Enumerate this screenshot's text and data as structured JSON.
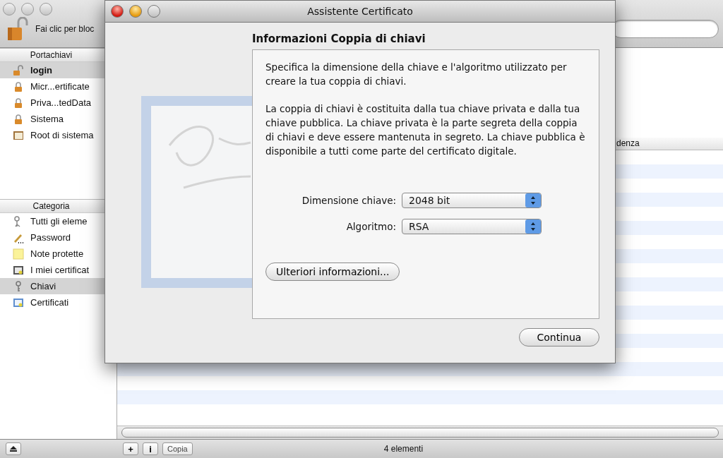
{
  "background_window": {
    "toolbar": {
      "lock_label": "Fai clic per bloc"
    },
    "keychains": {
      "header": "Portachiavi",
      "items": [
        {
          "label": "login",
          "kind": "unlocked",
          "selected": true
        },
        {
          "label": "Micr...ertificate",
          "kind": "locked",
          "selected": false
        },
        {
          "label": "Priva...tedData",
          "kind": "locked",
          "selected": false
        },
        {
          "label": "Sistema",
          "kind": "locked",
          "selected": false
        },
        {
          "label": "Root di sistema",
          "kind": "cabinet",
          "selected": false
        }
      ]
    },
    "categories": {
      "header": "Categoria",
      "items": [
        {
          "label": "Tutti gli eleme",
          "kind": "people",
          "selected": false
        },
        {
          "label": "Password",
          "kind": "pen",
          "selected": false
        },
        {
          "label": "Note protette",
          "kind": "note",
          "selected": false
        },
        {
          "label": "I miei certificat",
          "kind": "mycert",
          "selected": false
        },
        {
          "label": "Chiavi",
          "kind": "key",
          "selected": true
        },
        {
          "label": "Certificati",
          "kind": "cert",
          "selected": false
        }
      ]
    },
    "table": {
      "columns": [
        {
          "label": "denza"
        }
      ]
    },
    "bottom_bar": {
      "buttons": [
        {
          "label": "+"
        },
        {
          "label": "i"
        },
        {
          "label": "Copia"
        }
      ],
      "count": "4 elementi"
    }
  },
  "dialog": {
    "title": "Assistente Certificato",
    "heading": "Informazioni Coppia di chiavi",
    "paragraphs": [
      "Specifica la dimensione della chiave e l'algoritmo utilizzato per creare la tua coppia di chiavi.",
      "La coppia di chiavi è costituita dalla tua chiave privata e dalla tua chiave pubblica. La chiave privata è la parte segreta della coppia di chiavi e deve essere mantenuta in segreto. La chiave pubblica è disponibile a tutti come parte del certificato digitale."
    ],
    "fields": [
      {
        "label": "Dimensione chiave:",
        "value": "2048 bit"
      },
      {
        "label": "Algoritmo:",
        "value": "RSA"
      }
    ],
    "more_button": "Ulteriori informazioni...",
    "continue_button": "Continua"
  }
}
